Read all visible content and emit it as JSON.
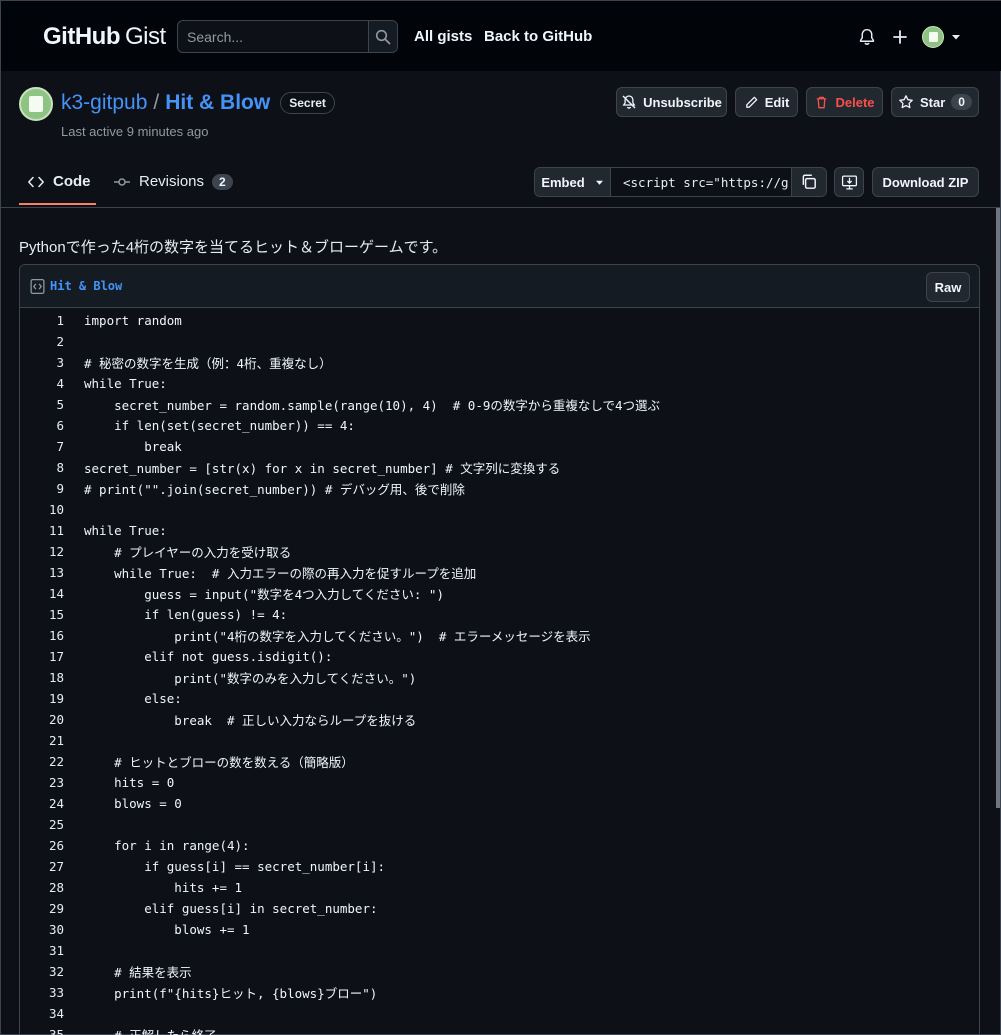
{
  "header": {
    "logo_bold": "GitHub",
    "logo_light": "Gist",
    "search_placeholder": "Search...",
    "nav": [
      "All gists",
      "Back to GitHub"
    ]
  },
  "gist": {
    "owner": "k3-gitpub",
    "separator": "/",
    "name": "Hit & Blow",
    "badge": "Secret",
    "last_active": "Last active 9 minutes ago"
  },
  "actions": {
    "unsubscribe": "Unsubscribe",
    "edit": "Edit",
    "delete": "Delete",
    "star": "Star",
    "star_count": "0"
  },
  "tabs": {
    "code": "Code",
    "revisions": "Revisions",
    "revisions_count": "2"
  },
  "embed": {
    "label": "Embed",
    "value": "<script src=\"https://g",
    "download": "Download ZIP"
  },
  "description": "Pythonで作った4桁の数字を当てるヒット＆ブローゲームです。",
  "file": {
    "name": "Hit & Blow",
    "raw": "Raw",
    "lines": [
      "import random",
      "",
      "# 秘密の数字を生成（例：4桁、重複なし）",
      "while True:",
      "    secret_number = random.sample(range(10), 4)  # 0-9の数字から重複なしで4つ選ぶ",
      "    if len(set(secret_number)) == 4:",
      "        break",
      "secret_number = [str(x) for x in secret_number] # 文字列に変換する",
      "# print(\"\".join(secret_number)) # デバッグ用、後で削除",
      "",
      "while True:",
      "    # プレイヤーの入力を受け取る",
      "    while True:  # 入力エラーの際の再入力を促すループを追加",
      "        guess = input(\"数字を4つ入力してください: \")",
      "        if len(guess) != 4:",
      "            print(\"4桁の数字を入力してください。\")  # エラーメッセージを表示",
      "        elif not guess.isdigit():",
      "            print(\"数字のみを入力してください。\")",
      "        else:",
      "            break  # 正しい入力ならループを抜ける",
      "",
      "    # ヒットとブローの数を数える（簡略版）",
      "    hits = 0",
      "    blows = 0",
      "",
      "    for i in range(4):",
      "        if guess[i] == secret_number[i]:",
      "            hits += 1",
      "        elif guess[i] in secret_number:",
      "            blows += 1",
      "",
      "    # 結果を表示",
      "    print(f\"{hits}ヒット, {blows}ブロー\")",
      "",
      "    # 正解したら終了"
    ]
  },
  "icons": {
    "search": "search-icon",
    "bell": "bell-icon",
    "plus": "plus-icon",
    "caret": "triangle-down-icon",
    "bell_slash": "bell-slash-icon",
    "pencil": "pencil-icon",
    "trash": "trash-icon",
    "star": "star-icon",
    "code": "code-icon",
    "commit": "git-commit-icon",
    "copy": "copy-icon",
    "desktop_download": "desktop-download-icon",
    "file_code": "file-code-icon"
  }
}
